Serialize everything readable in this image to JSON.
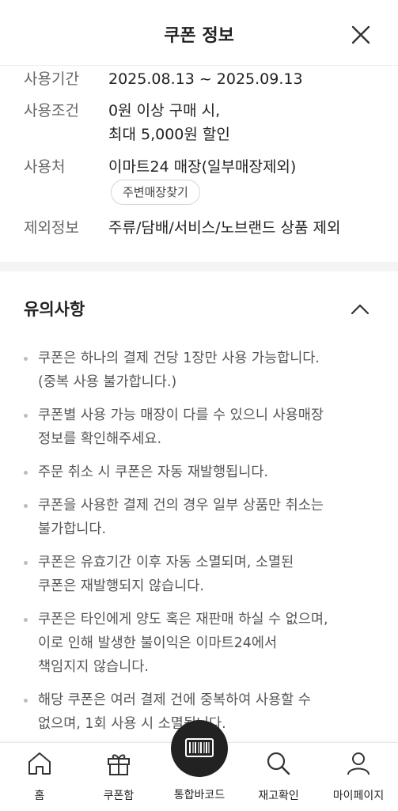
{
  "header": {
    "title": "쿠폰 정보"
  },
  "info": {
    "period_label": "사용기간",
    "period_value": "2025.08.13 ~ 2025.09.13",
    "condition_label": "사용조건",
    "condition_line1": "0원 이상 구매 시,",
    "condition_line2": "최대 5,000원 할인",
    "place_label": "사용처",
    "place_value": "이마트24 매장(일부매장제외)",
    "store_button": "주변매장찾기",
    "exclude_label": "제외정보",
    "exclude_value": "주류/담배/서비스/노브랜드 상품 제외"
  },
  "notice": {
    "title": "유의사항",
    "items": [
      [
        "쿠폰은 하나의 결제 건당 1장만 사용 가능합니다.",
        "(중복 사용 불가합니다.)"
      ],
      [
        "쿠폰별 사용 가능 매장이 다를 수 있으니 사용매장",
        "정보를 확인해주세요."
      ],
      [
        "주문 취소 시 쿠폰은 자동 재발행됩니다."
      ],
      [
        "쿠폰을 사용한 결제 건의 경우 일부 상품만 취소는",
        "불가합니다."
      ],
      [
        "쿠폰은 유효기간 이후 자동 소멸되며, 소멸된",
        "쿠폰은 재발행되지 않습니다."
      ],
      [
        "쿠폰은 타인에게 양도 혹은 재판매 하실 수 없으며,",
        "이로 인해 발생한 불이익은 이마트24에서",
        "책임지지 않습니다."
      ],
      [
        "해당 쿠폰은 여러 결제 건에 중복하여 사용할 수",
        "없으며, 1회 사용 시 소멸됩니다."
      ]
    ]
  },
  "nav": {
    "home": "홈",
    "coupons": "쿠폰함",
    "barcode": "통합바코드",
    "stock": "재고확인",
    "mypage": "마이페이지"
  },
  "colors": {
    "accent_dark": "#222222",
    "label_gray": "#666666",
    "divider": "#f4f4f4"
  }
}
